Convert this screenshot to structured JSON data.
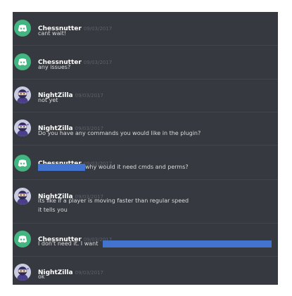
{
  "messages": [
    {
      "author": "Chessnutter",
      "timestamp": "09/03/2017",
      "avatar": "discord-logo-icon",
      "lines": [
        "cant wait!"
      ]
    },
    {
      "author": "Chessnutter",
      "timestamp": "09/03/2017",
      "avatar": "discord-logo-icon",
      "lines": [
        "any issues?"
      ]
    },
    {
      "author": "NightZilla",
      "timestamp": "09/03/2017",
      "avatar": "ninja-avatar-icon",
      "lines": [
        "not yet"
      ]
    },
    {
      "author": "NightZilla",
      "timestamp": "09/03/2017",
      "avatar": "ninja-avatar-icon",
      "lines": [
        "Do you have any commands you would like in the plugin?"
      ]
    },
    {
      "author": "Chessnutter",
      "timestamp": "09/03/2017",
      "avatar": "discord-logo-icon",
      "lines": [
        "why would it need cmds and perms?"
      ]
    },
    {
      "author": "NightZilla",
      "timestamp": "09/03/2017",
      "avatar": "ninja-avatar-icon",
      "lines": [
        "its like if a player is moving faster than regular speed",
        "it tells you"
      ]
    },
    {
      "author": "Chessnutter",
      "timestamp": "09/03/2017",
      "avatar": "discord-logo-icon",
      "lines": [
        "I don't need it. I want"
      ]
    },
    {
      "author": "NightZilla",
      "timestamp": "09/03/2017",
      "avatar": "ninja-avatar-icon",
      "lines": [
        "ok"
      ]
    }
  ],
  "colors": {
    "background": "#36393f",
    "discord_green": "#43b581",
    "redaction_blue": "#4173cf",
    "author_text": "#ffffff",
    "message_text": "#dcddde",
    "timestamp_text": "#5d6168"
  }
}
